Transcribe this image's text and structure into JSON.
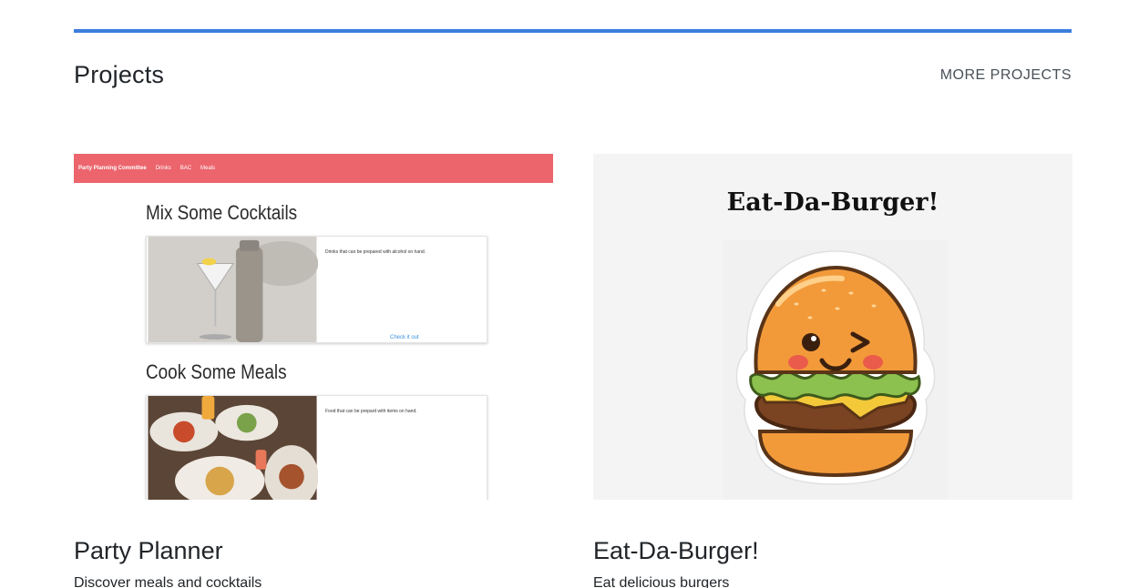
{
  "section": {
    "title": "Projects",
    "more_link": "MORE PROJECTS"
  },
  "colors": {
    "accent": "#3b7ddd",
    "party_nav": "#ec656d",
    "burger_bg": "#f4f4f4"
  },
  "projects": [
    {
      "title": "Party Planner",
      "description": "Discover meals and cocktails",
      "screenshot": {
        "nav_brand": "Party Planning Committee",
        "nav_items": [
          "Drinks",
          "BAC",
          "Meals"
        ],
        "heading_1": "Mix Some Cocktails",
        "panel_1_text": "Drinks that can be prepared with alcohol on hand.",
        "panel_1_link": "Check it out",
        "heading_2": "Cook Some Meals",
        "panel_2_text": "Food that can be prepard with items on hand."
      }
    },
    {
      "title": "Eat-Da-Burger!",
      "description": "Eat delicious burgers",
      "screenshot": {
        "heading": "Eat-Da-Burger!"
      }
    }
  ]
}
